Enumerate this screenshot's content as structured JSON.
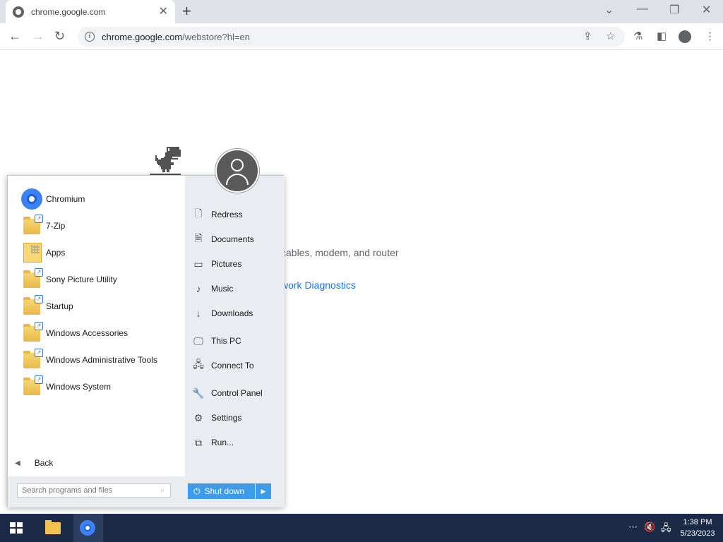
{
  "browser": {
    "tab_title": "chrome.google.com",
    "url_host": "chrome.google.com",
    "url_path": "/webstore?hl=en"
  },
  "page": {
    "text_line": "cables, modem, and router",
    "link_text": "work Diagnostics"
  },
  "start_menu": {
    "programs": [
      {
        "label": "Chromium",
        "icon": "chromium-icon"
      },
      {
        "label": "7-Zip",
        "icon": "folder-icon"
      },
      {
        "label": "Apps",
        "icon": "apps-folder-icon"
      },
      {
        "label": "Sony Picture Utility",
        "icon": "folder-icon"
      },
      {
        "label": "Startup",
        "icon": "folder-icon"
      },
      {
        "label": "Windows Accessories",
        "icon": "folder-icon"
      },
      {
        "label": "Windows Administrative Tools",
        "icon": "folder-icon"
      },
      {
        "label": "Windows System",
        "icon": "folder-icon"
      }
    ],
    "back_label": "Back",
    "places": [
      {
        "label": "Redress",
        "icon": "user-folder-icon"
      },
      {
        "label": "Documents",
        "icon": "document-icon"
      },
      {
        "label": "Pictures",
        "icon": "picture-icon"
      },
      {
        "label": "Music",
        "icon": "music-icon"
      },
      {
        "label": "Downloads",
        "icon": "download-icon"
      },
      {
        "label": "This PC",
        "icon": "computer-icon"
      },
      {
        "label": "Connect To",
        "icon": "network-icon"
      },
      {
        "label": "Control Panel",
        "icon": "wrench-icon"
      },
      {
        "label": "Settings",
        "icon": "gear-icon"
      },
      {
        "label": "Run...",
        "icon": "run-icon"
      }
    ],
    "search_placeholder": "Search programs and files",
    "shutdown_label": "Shut down"
  },
  "taskbar": {
    "time": "1:38 PM",
    "date": "5/23/2023"
  }
}
